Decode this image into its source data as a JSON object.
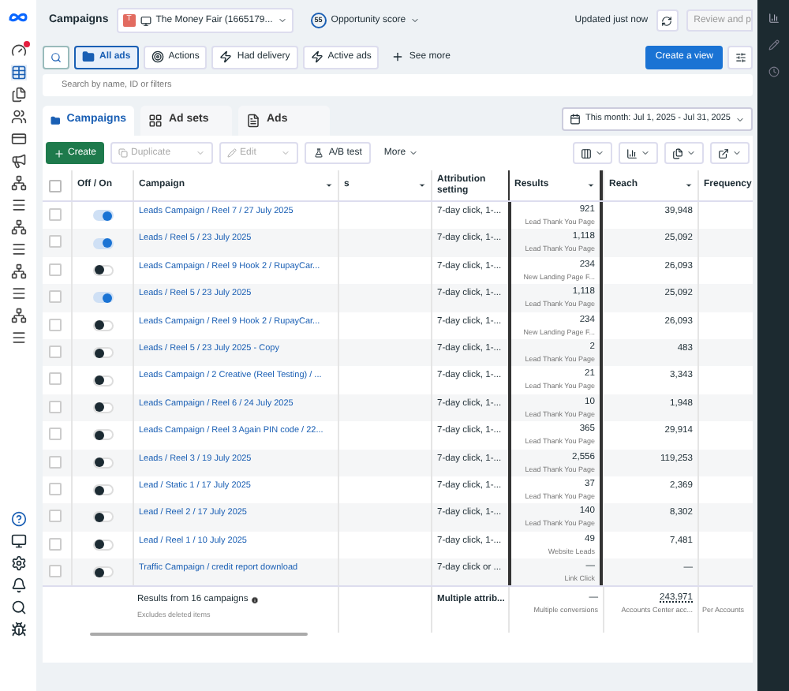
{
  "header": {
    "title": "Campaigns",
    "account_initial": "T",
    "account": "The Money Fair (1665179...",
    "opportunity_score": "55",
    "opportunity_label": "Opportunity score",
    "updated": "Updated just now",
    "review": "Review and p"
  },
  "filters": [
    {
      "label": "All ads",
      "selected": true,
      "kind": "folder"
    },
    {
      "label": "Actions",
      "selected": false,
      "kind": "actions"
    },
    {
      "label": "Had delivery",
      "selected": false,
      "kind": "bolt"
    },
    {
      "label": "Active ads",
      "selected": false,
      "kind": "bolt"
    },
    {
      "label": "See more",
      "selected": false,
      "kind": "plus"
    }
  ],
  "create_view": "Create a view",
  "search": {
    "placeholder": "Search by name, ID or filters"
  },
  "tabs": [
    {
      "label": "Campaigns",
      "selected": true
    },
    {
      "label": "Ad sets",
      "selected": false
    },
    {
      "label": "Ads",
      "selected": false
    }
  ],
  "date_range": "This month: Jul 1, 2025 - Jul 31, 2025",
  "toolbar": {
    "create": "Create",
    "duplicate": "Duplicate",
    "edit": "Edit",
    "ab_test": "A/B test",
    "more": "More"
  },
  "table": {
    "all_checked": false,
    "columns": [
      "Off / On",
      "Campaign",
      "s",
      "Attribution setting",
      "Results",
      "Reach",
      "Frequency"
    ],
    "rows": [
      {
        "checked": false,
        "on": true,
        "campaign": "Leads Campaign / Reel 7 / 27 July 2025",
        "attribution": "7-day click, 1-...",
        "result": "921",
        "result_type": "Lead Thank You Page",
        "reach": "39,948"
      },
      {
        "checked": false,
        "on": true,
        "campaign": "Leads / Reel 5 / 23 July 2025",
        "attribution": "7-day click, 1-...",
        "result": "1,118",
        "result_type": "Lead Thank You Page",
        "reach": "25,092"
      },
      {
        "checked": false,
        "on": false,
        "campaign": "Leads Campaign / Reel 9 Hook 2 / RupayCar...",
        "attribution": "7-day click, 1-...",
        "result": "234",
        "result_type": "New Landing Page F...",
        "reach": "26,093"
      },
      {
        "checked": false,
        "on": true,
        "campaign": "Leads / Reel 5 / 23 July 2025",
        "attribution": "7-day click, 1-...",
        "result": "1,118",
        "result_type": "Lead Thank You Page",
        "reach": "25,092"
      },
      {
        "checked": false,
        "on": false,
        "campaign": "Leads Campaign / Reel 9 Hook 2 / RupayCar...",
        "attribution": "7-day click, 1-...",
        "result": "234",
        "result_type": "New Landing Page F...",
        "reach": "26,093"
      },
      {
        "checked": false,
        "on": false,
        "campaign": "Leads / Reel 5 / 23 July 2025 - Copy",
        "attribution": "7-day click, 1-...",
        "result": "2",
        "result_type": "Lead Thank You Page",
        "reach": "483"
      },
      {
        "checked": false,
        "on": false,
        "campaign": "Leads Campaign / 2 Creative (Reel Testing) / ...",
        "attribution": "7-day click, 1-...",
        "result": "21",
        "result_type": "Lead Thank You Page",
        "reach": "3,343"
      },
      {
        "checked": false,
        "on": false,
        "campaign": "Leads Campaign / Reel 6 / 24 July 2025",
        "attribution": "7-day click, 1-...",
        "result": "10",
        "result_type": "Lead Thank You Page",
        "reach": "1,948"
      },
      {
        "checked": false,
        "on": false,
        "campaign": "Leads Campaign / Reel 3 Again PIN code / 22...",
        "attribution": "7-day click, 1-...",
        "result": "365",
        "result_type": "Lead Thank You Page",
        "reach": "29,914"
      },
      {
        "checked": false,
        "on": false,
        "campaign": "Leads / Reel 3 / 19 July 2025",
        "attribution": "7-day click, 1-...",
        "result": "2,556",
        "result_type": "Lead Thank You Page",
        "reach": "119,253"
      },
      {
        "checked": false,
        "on": false,
        "campaign": "Lead / Static 1 / 17 July 2025",
        "attribution": "7-day click, 1-...",
        "result": "37",
        "result_type": "Lead Thank You Page",
        "reach": "2,369"
      },
      {
        "checked": false,
        "on": false,
        "campaign": "Lead / Reel 2 / 17 July 2025",
        "attribution": "7-day click, 1-...",
        "result": "140",
        "result_type": "Lead Thank You Page",
        "reach": "8,302"
      },
      {
        "checked": false,
        "on": false,
        "campaign": "Lead / Reel 1 / 10 July 2025",
        "attribution": "7-day click, 1-...",
        "result": "49",
        "result_type": "Website Leads",
        "reach": "7,481"
      },
      {
        "checked": false,
        "on": false,
        "campaign": "Traffic Campaign / credit report download",
        "attribution": "7-day click or ...",
        "result": "—",
        "result_type": "Link Click",
        "reach": "—"
      }
    ],
    "footer": {
      "summary": "Results from 16 campaigns",
      "note": "Excludes deleted items",
      "attribution": "Multiple attrib...",
      "result": "—",
      "result_type": "Multiple conversions",
      "reach": "243,971",
      "reach_note": "Accounts Center acc...",
      "frequency_note": "Per Accounts"
    }
  }
}
